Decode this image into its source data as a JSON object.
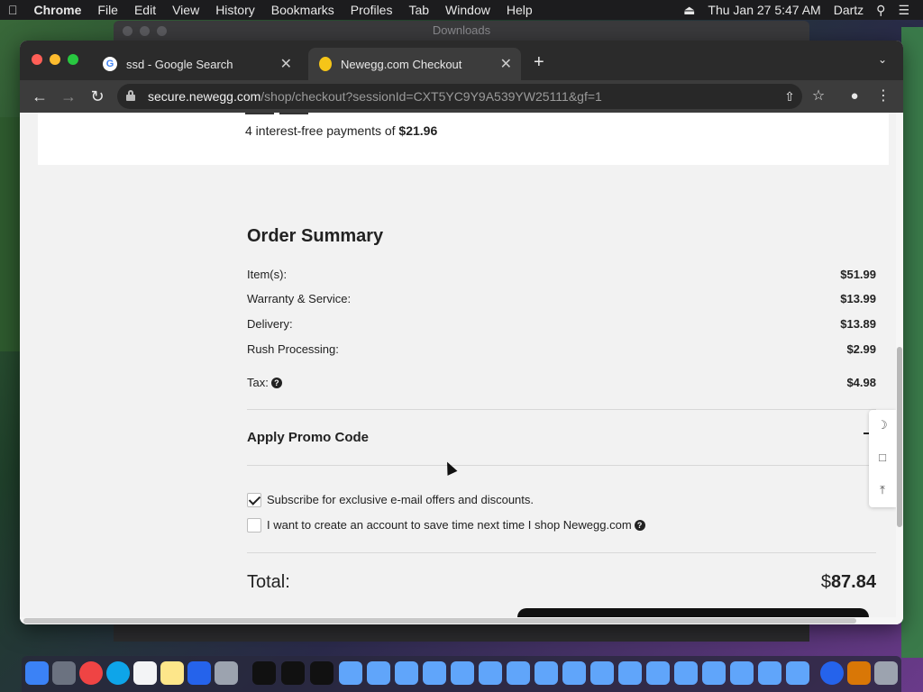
{
  "menubar": {
    "app_name": "Chrome",
    "items": [
      "File",
      "Edit",
      "View",
      "History",
      "Bookmarks",
      "Profiles",
      "Tab",
      "Window",
      "Help"
    ],
    "clock": "Thu Jan 27  5:47 AM",
    "user": "Dartz"
  },
  "background_window": {
    "title": "Downloads"
  },
  "browser": {
    "tabs": [
      {
        "title": "ssd - Google Search",
        "favicon": "G"
      },
      {
        "title": "Newegg.com Checkout",
        "favicon": "egg"
      }
    ],
    "url_host": "secure.newegg.com",
    "url_path": "/shop/checkout?sessionId=CXT5YC9Y9A539YW25111&gf=1"
  },
  "payment": {
    "prefix": "4 interest-free payments of ",
    "amount": "$21.96"
  },
  "order_summary": {
    "title": "Order Summary",
    "rows": [
      {
        "label": "Item(s):",
        "amount": "$51.99"
      },
      {
        "label": "Warranty & Service:",
        "amount": "$13.99"
      },
      {
        "label": "Delivery:",
        "amount": "$13.89"
      },
      {
        "label": "Rush Processing:",
        "amount": "$2.99"
      },
      {
        "label": "Tax:",
        "amount": "$4.98"
      }
    ],
    "promo_label": "Apply Promo Code",
    "subscribe_label": "Subscribe for exclusive e-mail offers and discounts.",
    "subscribe_checked": true,
    "account_label": "I want to create an account to save time next time I shop Newegg.com",
    "account_checked": false,
    "total_label": "Total:",
    "total_currency": "$",
    "total_amount": "87.84"
  },
  "colors": {
    "page_bg": "#f2f2f2",
    "text": "#222222",
    "chrome_dark": "#2b2b2b"
  },
  "icons": {
    "side_tools": [
      "moon-icon",
      "feedback-icon",
      "back-to-top-icon"
    ]
  }
}
